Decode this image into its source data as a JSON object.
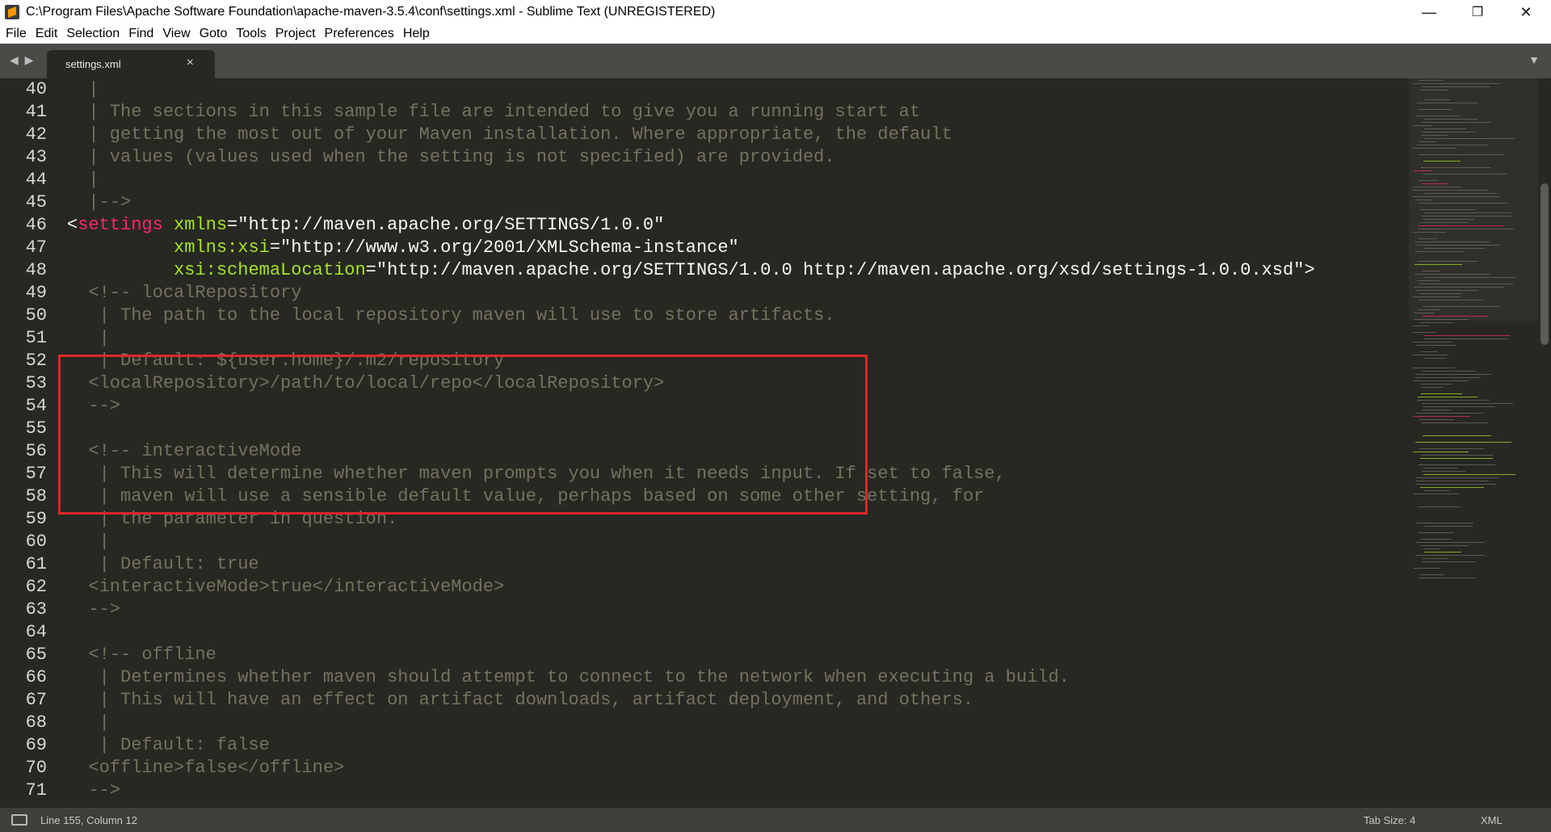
{
  "window": {
    "title": "C:\\Program Files\\Apache Software Foundation\\apache-maven-3.5.4\\conf\\settings.xml - Sublime Text (UNREGISTERED)",
    "minimize": "—",
    "restore": "❐",
    "close": "✕"
  },
  "menu": [
    "File",
    "Edit",
    "Selection",
    "Find",
    "View",
    "Goto",
    "Tools",
    "Project",
    "Preferences",
    "Help"
  ],
  "tabs": {
    "nav": "◀ ▶",
    "active": "settings.xml",
    "close": "×",
    "dropdown": "▼"
  },
  "editor": {
    "lines": [
      {
        "n": "40",
        "segs": [
          [
            "cm",
            "  |"
          ]
        ]
      },
      {
        "n": "41",
        "segs": [
          [
            "cm",
            "  | The sections in this sample file are intended to give you a running start at"
          ]
        ]
      },
      {
        "n": "42",
        "segs": [
          [
            "cm",
            "  | getting the most out of your Maven installation. Where appropriate, the default"
          ]
        ]
      },
      {
        "n": "43",
        "segs": [
          [
            "cm",
            "  | values (values used when the setting is not specified) are provided."
          ]
        ]
      },
      {
        "n": "44",
        "segs": [
          [
            "cm",
            "  |"
          ]
        ]
      },
      {
        "n": "45",
        "segs": [
          [
            "cm",
            "  |-->"
          ]
        ]
      },
      {
        "n": "46",
        "segs": [
          [
            "tx",
            "<"
          ],
          [
            "tg",
            "settings"
          ],
          [
            "tx",
            " "
          ],
          [
            "at",
            "xmlns"
          ],
          [
            "tx",
            "=\"http://maven.apache.org/SETTINGS/1.0.0\""
          ]
        ]
      },
      {
        "n": "47",
        "segs": [
          [
            "tx",
            "          "
          ],
          [
            "at",
            "xmlns:xsi"
          ],
          [
            "tx",
            "=\"http://www.w3.org/2001/XMLSchema-instance\""
          ]
        ]
      },
      {
        "n": "48",
        "segs": [
          [
            "tx",
            "          "
          ],
          [
            "at",
            "xsi:schemaLocation"
          ],
          [
            "tx",
            "=\"http://maven.apache.org/SETTINGS/1.0.0 http://maven.apache.org/xsd/settings-1.0.0.xsd\">"
          ]
        ]
      },
      {
        "n": "49",
        "segs": [
          [
            "cm",
            "  <!-- localRepository"
          ]
        ]
      },
      {
        "n": "50",
        "segs": [
          [
            "cm",
            "   | The path to the local repository maven will use to store artifacts."
          ]
        ]
      },
      {
        "n": "51",
        "segs": [
          [
            "cm",
            "   |"
          ]
        ]
      },
      {
        "n": "52",
        "segs": [
          [
            "cm",
            "   | Default: ${user.home}/.m2/repository"
          ]
        ]
      },
      {
        "n": "53",
        "segs": [
          [
            "cm",
            "  <localRepository>/path/to/local/repo</localRepository>"
          ]
        ]
      },
      {
        "n": "54",
        "segs": [
          [
            "cm",
            "  -->"
          ]
        ]
      },
      {
        "n": "55",
        "segs": [
          [
            "cm",
            ""
          ]
        ]
      },
      {
        "n": "56",
        "segs": [
          [
            "cm",
            "  <!-- interactiveMode"
          ]
        ]
      },
      {
        "n": "57",
        "segs": [
          [
            "cm",
            "   | This will determine whether maven prompts you when it needs input. If set to false,"
          ]
        ]
      },
      {
        "n": "58",
        "segs": [
          [
            "cm",
            "   | maven will use a sensible default value, perhaps based on some other setting, for"
          ]
        ]
      },
      {
        "n": "59",
        "segs": [
          [
            "cm",
            "   | the parameter in question."
          ]
        ]
      },
      {
        "n": "60",
        "segs": [
          [
            "cm",
            "   |"
          ]
        ]
      },
      {
        "n": "61",
        "segs": [
          [
            "cm",
            "   | Default: true"
          ]
        ]
      },
      {
        "n": "62",
        "segs": [
          [
            "cm",
            "  <interactiveMode>true</interactiveMode>"
          ]
        ]
      },
      {
        "n": "63",
        "segs": [
          [
            "cm",
            "  -->"
          ]
        ]
      },
      {
        "n": "64",
        "segs": [
          [
            "cm",
            ""
          ]
        ]
      },
      {
        "n": "65",
        "segs": [
          [
            "cm",
            "  <!-- offline"
          ]
        ]
      },
      {
        "n": "66",
        "segs": [
          [
            "cm",
            "   | Determines whether maven should attempt to connect to the network when executing a build."
          ]
        ]
      },
      {
        "n": "67",
        "segs": [
          [
            "cm",
            "   | This will have an effect on artifact downloads, artifact deployment, and others."
          ]
        ]
      },
      {
        "n": "68",
        "segs": [
          [
            "cm",
            "   |"
          ]
        ]
      },
      {
        "n": "69",
        "segs": [
          [
            "cm",
            "   | Default: false"
          ]
        ]
      },
      {
        "n": "70",
        "segs": [
          [
            "cm",
            "  <offline>false</offline>"
          ]
        ]
      },
      {
        "n": "71",
        "segs": [
          [
            "cm",
            "  -->"
          ]
        ]
      }
    ]
  },
  "status": {
    "position": "Line 155, Column 12",
    "tab_size": "Tab Size: 4",
    "syntax": "XML"
  },
  "colors": {
    "background": "#272822",
    "comment": "#75715e",
    "tag": "#f92672",
    "attribute": "#a6e22e",
    "highlight_box": "#e0262b"
  }
}
